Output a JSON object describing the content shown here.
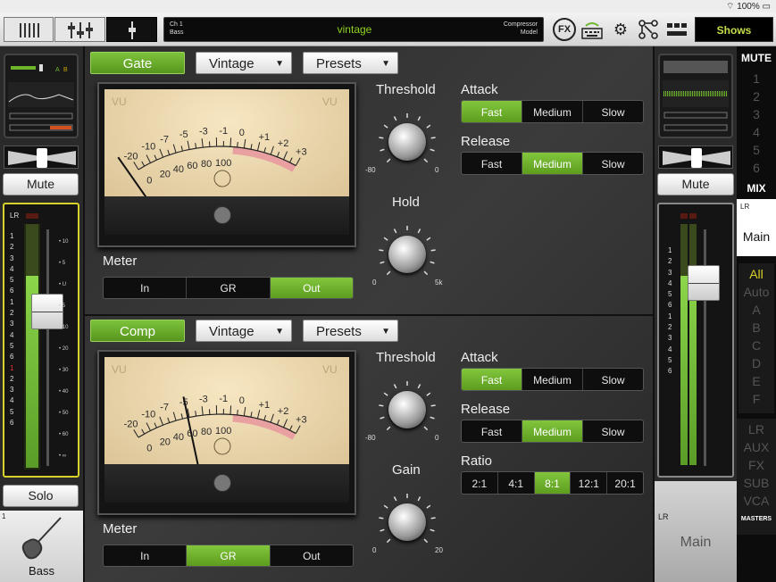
{
  "status": {
    "battery": "100%"
  },
  "topbar": {
    "channel_number": "Ch 1",
    "channel_name_small": "Bass",
    "channel_name": "vintage",
    "model_type": "Compressor",
    "model_label": "Model",
    "fx_label": "FX",
    "shows_label": "Shows"
  },
  "left_strip": {
    "mute_label": "Mute",
    "solo_label": "Solo",
    "lr_label": "LR",
    "ab_a": "A",
    "ab_b": "B",
    "channel_number": "1",
    "channel_name": "Bass",
    "scale_left": [
      "1",
      "2",
      "3",
      "4",
      "5",
      "6",
      "1",
      "2",
      "3",
      "4",
      "5",
      "6",
      "1",
      "2",
      "3",
      "4",
      "5",
      "6"
    ],
    "scale_right": [
      "10",
      "5",
      "U",
      "5",
      "10",
      "20",
      "30",
      "40",
      "50",
      "60",
      "∞"
    ]
  },
  "gate": {
    "toggle_label": "Gate",
    "model_select": "Vintage",
    "presets_label": "Presets",
    "meter_label": "Meter",
    "meter_options": [
      "In",
      "GR",
      "Out"
    ],
    "meter_selected": "Out",
    "threshold_label": "Threshold",
    "threshold_min": "-80",
    "threshold_max": "0",
    "hold_label": "Hold",
    "hold_min": "0",
    "hold_max": "5k",
    "attack_label": "Attack",
    "attack_options": [
      "Fast",
      "Medium",
      "Slow"
    ],
    "attack_selected": "Fast",
    "release_label": "Release",
    "release_options": [
      "Fast",
      "Medium",
      "Slow"
    ],
    "release_selected": "Medium"
  },
  "comp": {
    "toggle_label": "Comp",
    "model_select": "Vintage",
    "presets_label": "Presets",
    "meter_label": "Meter",
    "meter_options": [
      "In",
      "GR",
      "Out"
    ],
    "meter_selected": "GR",
    "threshold_label": "Threshold",
    "threshold_min": "-80",
    "threshold_max": "0",
    "gain_label": "Gain",
    "gain_min": "0",
    "gain_max": "20",
    "attack_label": "Attack",
    "attack_options": [
      "Fast",
      "Medium",
      "Slow"
    ],
    "attack_selected": "Fast",
    "release_label": "Release",
    "release_options": [
      "Fast",
      "Medium",
      "Slow"
    ],
    "release_selected": "Medium",
    "ratio_label": "Ratio",
    "ratio_options": [
      "2:1",
      "4:1",
      "8:1",
      "12:1",
      "20:1"
    ],
    "ratio_selected": "8:1"
  },
  "vu": {
    "label_left": "VU",
    "label_right": "VU",
    "db_scale": [
      "-20",
      "-10",
      "-7",
      "-5",
      "-3",
      "-1",
      "0",
      "+1",
      "+2",
      "+3"
    ],
    "pct_scale": [
      "0",
      "20",
      "40",
      "60",
      "80",
      "100"
    ]
  },
  "right_strip": {
    "mute_label": "Mute",
    "lr_label": "LR",
    "main_label": "Main",
    "bottom_lr": "LR",
    "bottom_main": "Main"
  },
  "right_panel": {
    "mute_label": "MUTE",
    "mute_groups": [
      "1",
      "2",
      "3",
      "4",
      "5",
      "6"
    ],
    "mix_label": "MIX",
    "mix_items": [
      "All",
      "Auto",
      "A",
      "B",
      "C",
      "D",
      "E",
      "F"
    ],
    "mix_selected": "All",
    "master_items": [
      "LR",
      "AUX",
      "FX",
      "SUB",
      "VCA"
    ],
    "masters_label": "MASTERS"
  },
  "colors": {
    "accent_green": "#6fb52c",
    "channel_name": "#8fd321",
    "shows_text": "#c4df4a"
  }
}
